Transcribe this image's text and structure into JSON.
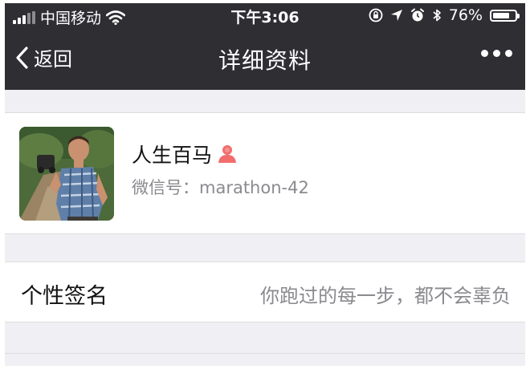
{
  "status_bar": {
    "carrier": "中国移动",
    "time": "下午3:06",
    "battery": "76%",
    "battery_level": 0.76
  },
  "nav": {
    "back_label": "返回",
    "title": "详细资料",
    "more_icon": "ellipsis-icon"
  },
  "profile": {
    "nickname": "人生百马",
    "gender_icon": "female-icon",
    "wechat_id": "微信号：marathon-42"
  },
  "signature": {
    "label": "个性签名",
    "value": "你跑过的每一步，都不会辜负"
  },
  "colors": {
    "bar": "#2e2e33",
    "page_bg": "#efeff4",
    "female_icon": "#f26d6d",
    "secondary_text": "#8a8a8f"
  }
}
